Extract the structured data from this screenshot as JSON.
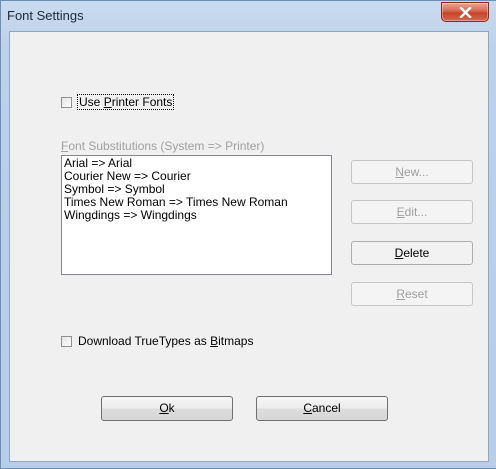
{
  "window": {
    "title": "Font Settings"
  },
  "use_printer_fonts": {
    "label_pre": "Use ",
    "label_accel": "P",
    "label_post": "rinter Fonts",
    "checked": false
  },
  "substitutions": {
    "label_accel": "F",
    "label_post": "ont Substitutions (System => Printer)",
    "items": [
      "Arial => Arial",
      "Courier New => Courier",
      "Symbol => Symbol",
      "Times New Roman => Times New Roman",
      "Wingdings => Wingdings"
    ]
  },
  "side_buttons": {
    "new": {
      "accel": "N",
      "rest": "ew...",
      "enabled": false
    },
    "edit": {
      "accel": "E",
      "rest": "dit...",
      "enabled": false
    },
    "delete": {
      "accel": "D",
      "rest": "elete",
      "enabled": true
    },
    "reset": {
      "accel": "R",
      "rest": "eset",
      "enabled": false
    }
  },
  "download_truetypes": {
    "label_pre": "Download TrueTypes as ",
    "label_accel": "B",
    "label_post": "itmaps",
    "checked": false
  },
  "dialog_buttons": {
    "ok": {
      "accel": "O",
      "rest": "k"
    },
    "cancel": {
      "accel": "C",
      "rest": "ancel"
    }
  },
  "icons": {
    "close": "close-icon"
  },
  "colors": {
    "title_bar": "#bcd1ea",
    "close_button": "#c5432a",
    "client_bg": "#f0f0f0"
  }
}
